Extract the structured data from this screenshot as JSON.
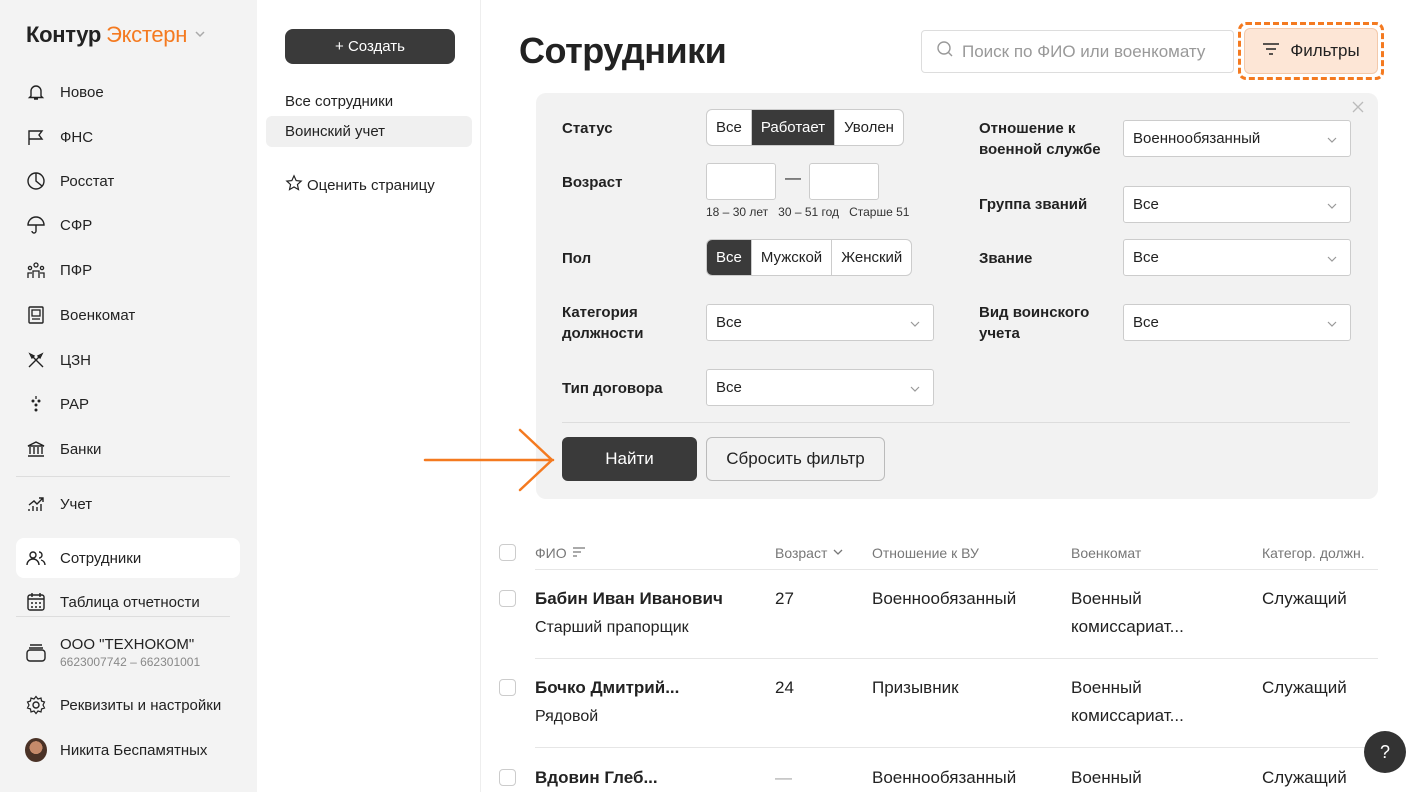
{
  "app": {
    "brand_part1": "Контур",
    "brand_part2": "Экстерн"
  },
  "sidebar": {
    "items": [
      {
        "label": "Новое",
        "icon": "bell-icon"
      },
      {
        "label": "ФНС",
        "icon": "flag-icon"
      },
      {
        "label": "Росстат",
        "icon": "pie-chart-icon"
      },
      {
        "label": "СФР",
        "icon": "umbrella-icon"
      },
      {
        "label": "ПФР",
        "icon": "people-icon"
      },
      {
        "label": "Военкомат",
        "icon": "military-icon"
      },
      {
        "label": "ЦЗН",
        "icon": "tools-icon"
      },
      {
        "label": "РАР",
        "icon": "grapes-icon"
      },
      {
        "label": "Банки",
        "icon": "bank-icon"
      },
      {
        "label": "Учет",
        "icon": "chart-growth-icon"
      },
      {
        "label": "Сотрудники",
        "icon": "employees-icon"
      },
      {
        "label": "Таблица отчетности",
        "icon": "calendar-icon"
      }
    ],
    "org_name": "ООО \"ТЕХНОКОМ\"",
    "org_ids": "6623007742 – 662301001",
    "settings": "Реквизиты и настройки",
    "user": "Никита Беспамятных"
  },
  "col2": {
    "create": "+ Создать",
    "links": [
      "Все сотрудники",
      "Воинский учет"
    ],
    "rate": "Оценить страницу"
  },
  "main": {
    "title": "Сотрудники",
    "search_placeholder": "Поиск по ФИО или военкомату",
    "filters_btn": "Фильтры"
  },
  "filters": {
    "status_label": "Статус",
    "status_options": [
      "Все",
      "Работает",
      "Уволен"
    ],
    "age_label": "Возраст",
    "age_dash": "—",
    "age_hints": [
      "18 – 30 лет",
      "30 – 51 год",
      "Старше 51"
    ],
    "sex_label": "Пол",
    "sex_options": [
      "Все",
      "Мужской",
      "Женский"
    ],
    "category_label_1": "Категория",
    "category_label_2": "должности",
    "category_value": "Все",
    "contract_label": "Тип договора",
    "contract_value": "Все",
    "service_label_1": "Отношение к",
    "service_label_2": "военной службе",
    "service_value": "Военнообязанный",
    "rank_group_label": "Группа званий",
    "rank_group_value": "Все",
    "rank_label": "Звание",
    "rank_value": "Все",
    "record_label_1": "Вид воинского",
    "record_label_2": "учета",
    "record_value": "Все",
    "find": "Найти",
    "reset": "Сбросить фильтр"
  },
  "table": {
    "headers": {
      "name": "ФИО",
      "age": "Возраст",
      "relation": "Отношение к ВУ",
      "office": "Военкомат",
      "category": "Категор. должн."
    },
    "rows": [
      {
        "name": "Бабин Иван Иванович",
        "rank": "Старший прапорщик",
        "age": "27",
        "relation": "Военнообязанный",
        "office1": "Военный",
        "office2": "комиссариат...",
        "category": "Служащий"
      },
      {
        "name": "Бочко Дмитрий...",
        "rank": "Рядовой",
        "age": "24",
        "relation": "Призывник",
        "office1": "Военный",
        "office2": "комиссариат...",
        "category": "Служащий"
      },
      {
        "name": "Вдовин Глеб...",
        "rank": "",
        "age": "—",
        "relation": "Военнообязанный",
        "office1": "Военный",
        "office2": "",
        "category": "Служащий"
      }
    ]
  },
  "help": "?"
}
